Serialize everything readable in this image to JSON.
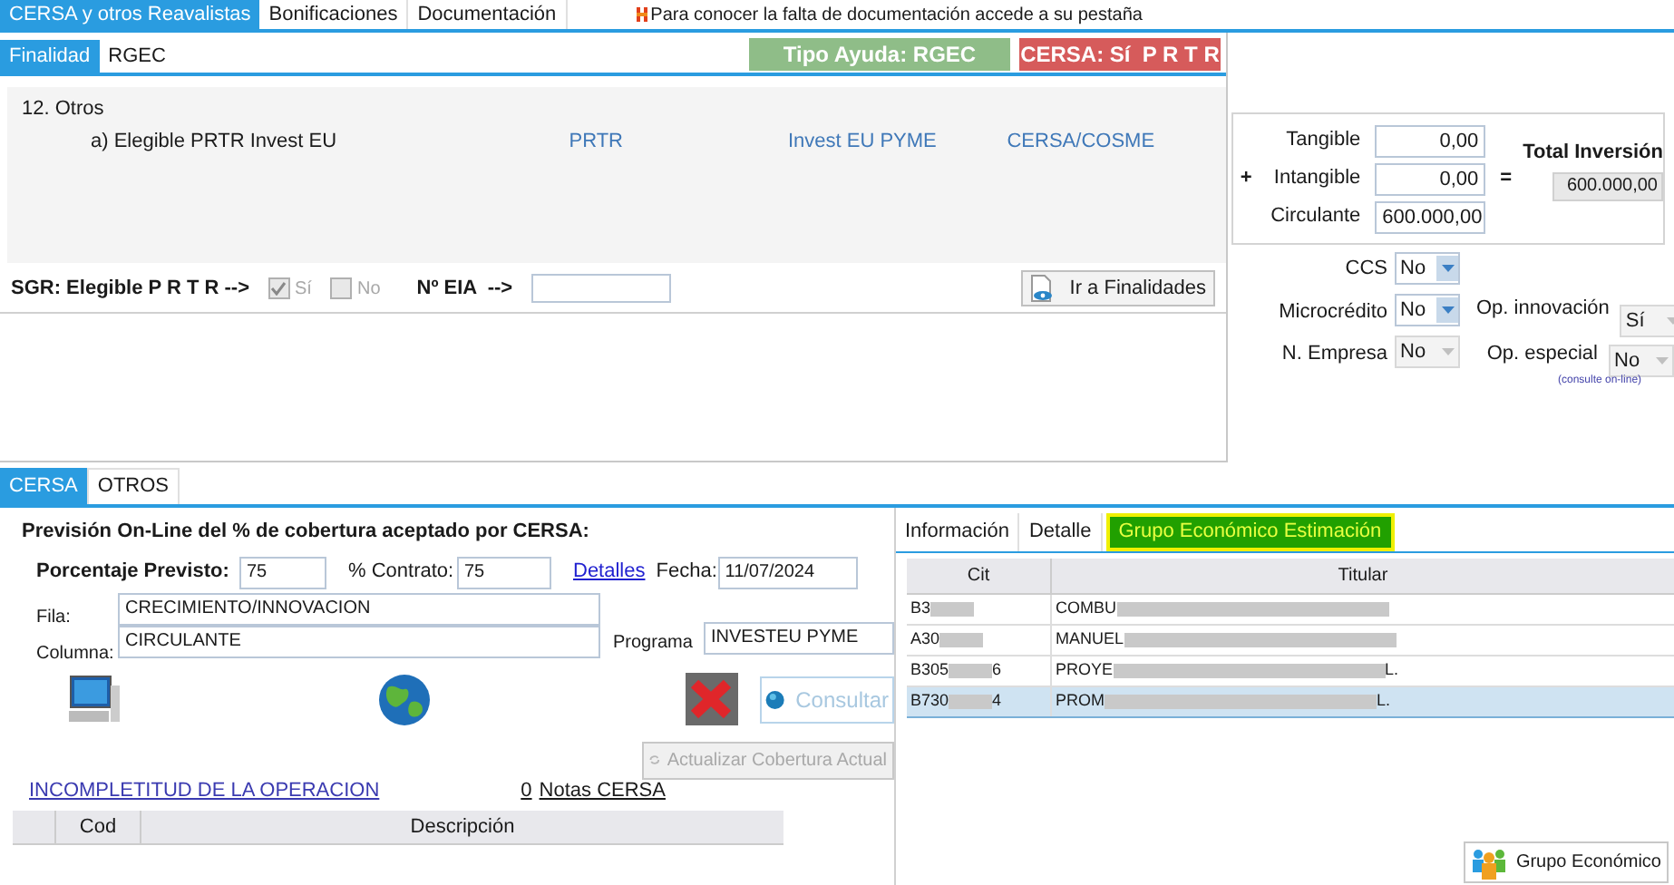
{
  "top_tabs": [
    {
      "label": "CERSA y otros Reavalistas",
      "selected": true
    },
    {
      "label": "Bonificaciones",
      "selected": false
    },
    {
      "label": "Documentación",
      "selected": false
    }
  ],
  "notice": "Para conocer la falta de documentación accede a su pestaña",
  "finalidad_tabs": [
    {
      "label": "Finalidad",
      "selected": true
    },
    {
      "label": "RGEC",
      "selected": false
    }
  ],
  "badges": [
    {
      "label": "Tipo Ayuda: RGEC",
      "color": "#8fbd88"
    },
    {
      "label": "CERSA: Sí  P R T R",
      "color": "#d65b5b"
    }
  ],
  "finalidades": {
    "group": "12. Otros",
    "items": [
      {
        "label": "a) Elegible PRTR Invest EU",
        "links": [
          "PRTR",
          "Invest EU PYME",
          "CERSA/COSME"
        ]
      }
    ]
  },
  "sgr": {
    "label": "SGR: Elegible P R T R -->",
    "options": [
      {
        "label": "Sí",
        "checked": true,
        "disabled": true
      },
      {
        "label": "No",
        "checked": false,
        "disabled": true
      }
    ],
    "eia_label": "Nº EIA  -->"
  },
  "ir_button": "Ir a Finalidades",
  "inversion": {
    "rows": [
      {
        "label": "Tangible",
        "value": "0,00"
      },
      {
        "label": "Intangible",
        "value": "0,00"
      },
      {
        "label": "Circulante",
        "value": "600.000,00"
      }
    ],
    "plus": "+",
    "equals": "=",
    "total_label": "Total Inversión",
    "total_value": "600.000,00"
  },
  "ccs": {
    "label": "CCS",
    "value": "No",
    "disabled": false
  },
  "microcredito": {
    "label": "Microcrédito",
    "value": "No",
    "disabled": false
  },
  "op_innovacion": {
    "label": "Op. innovación",
    "value": "Sí",
    "disabled": true
  },
  "n_empresa": {
    "label": "N. Empresa",
    "value": "No",
    "disabled": true
  },
  "op_especial": {
    "label": "Op. especial",
    "value": "No",
    "disabled": true,
    "note": "(consulte on-line)"
  },
  "bottom_tabs": [
    {
      "label": "CERSA",
      "selected": true
    },
    {
      "label": "OTROS",
      "selected": false
    }
  ],
  "cersa": {
    "title": "Previsión On-Line del % de cobertura aceptado por CERSA:",
    "porcentaje_label": "Porcentaje Previsto:",
    "porcentaje": "75",
    "contrato_label": "% Contrato:",
    "contrato": "75",
    "detalles": "Detalles",
    "fecha_label": "Fecha:",
    "fecha": "11/07/2024",
    "fila_label": "Fila:",
    "fila": "CRECIMIENTO/INNOVACION",
    "columna_label": "Columna:",
    "columna": "CIRCULANTE",
    "programa_label": "Programa",
    "programa": "INVESTEU PYME",
    "consultar": "Consultar",
    "actualizar": "Actualizar Cobertura Actual",
    "incompletitud": "INCOMPLETITUD DE LA OPERACION",
    "notas_count": "0",
    "notas": "Notas CERSA",
    "table_columns": [
      "Cod",
      "Descripción"
    ]
  },
  "right_tabs": [
    {
      "label": "Información",
      "selected": false
    },
    {
      "label": "Detalle",
      "selected": false
    },
    {
      "label": "Grupo Económico Estimación",
      "selected": true
    }
  ],
  "grupo_table": {
    "columns": [
      "Cit",
      "Titular"
    ],
    "rows": [
      {
        "cit": {
          "start": "B3"
        },
        "titular": {
          "start": "COMBU"
        },
        "selected": false
      },
      {
        "cit": {
          "start": "A30"
        },
        "titular": {
          "start": "MANUEL "
        },
        "selected": false
      },
      {
        "cit": {
          "start": "B305",
          "end": "6"
        },
        "titular": {
          "start": "PROYE",
          "end": "L."
        },
        "selected": false
      },
      {
        "cit": {
          "start": "B730",
          "end": "4"
        },
        "titular": {
          "start": "PROM",
          "end": "L."
        },
        "selected": true
      }
    ]
  },
  "grupo_button": "Grupo Económico"
}
